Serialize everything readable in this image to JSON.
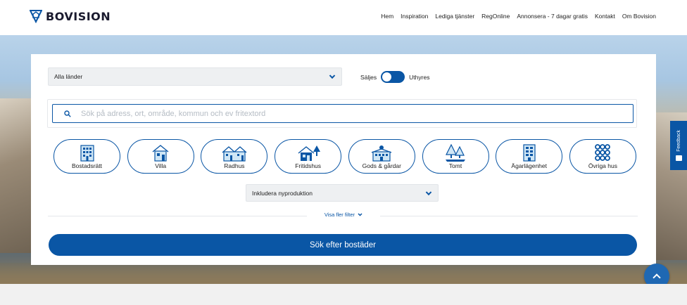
{
  "brand": {
    "name": "BOVISION",
    "accent": "#0a56a5"
  },
  "nav": [
    "Hem",
    "Inspiration",
    "Lediga tjänster",
    "RegOnline",
    "Annonsera - 7 dagar gratis",
    "Kontakt",
    "Om Bovision"
  ],
  "search": {
    "country_select": "Alla länder",
    "toggle": {
      "left_label": "Säljes",
      "right_label": "Uthyres",
      "state": "Säljes"
    },
    "placeholder": "Sök på adress, ort, område, kommun och ev fritextord",
    "property_types": [
      {
        "label": "Bostadsrätt",
        "icon": "apartment-building-icon"
      },
      {
        "label": "Villa",
        "icon": "villa-house-icon"
      },
      {
        "label": "Radhus",
        "icon": "townhouse-icon"
      },
      {
        "label": "Fritidshus",
        "icon": "cabin-icon"
      },
      {
        "label": "Gods & gårdar",
        "icon": "manor-icon"
      },
      {
        "label": "Tomt",
        "icon": "plot-trees-icon"
      },
      {
        "label": "Ägarlägenhet",
        "icon": "owner-apartment-icon"
      },
      {
        "label": "Övriga hus",
        "icon": "other-houses-dots-icon"
      }
    ],
    "new_production_select": "Inkludera nyproduktion",
    "more_filters": "Visa fler filter",
    "submit_label": "Sök efter bostäder"
  },
  "feedback": {
    "label": "Feedback"
  }
}
